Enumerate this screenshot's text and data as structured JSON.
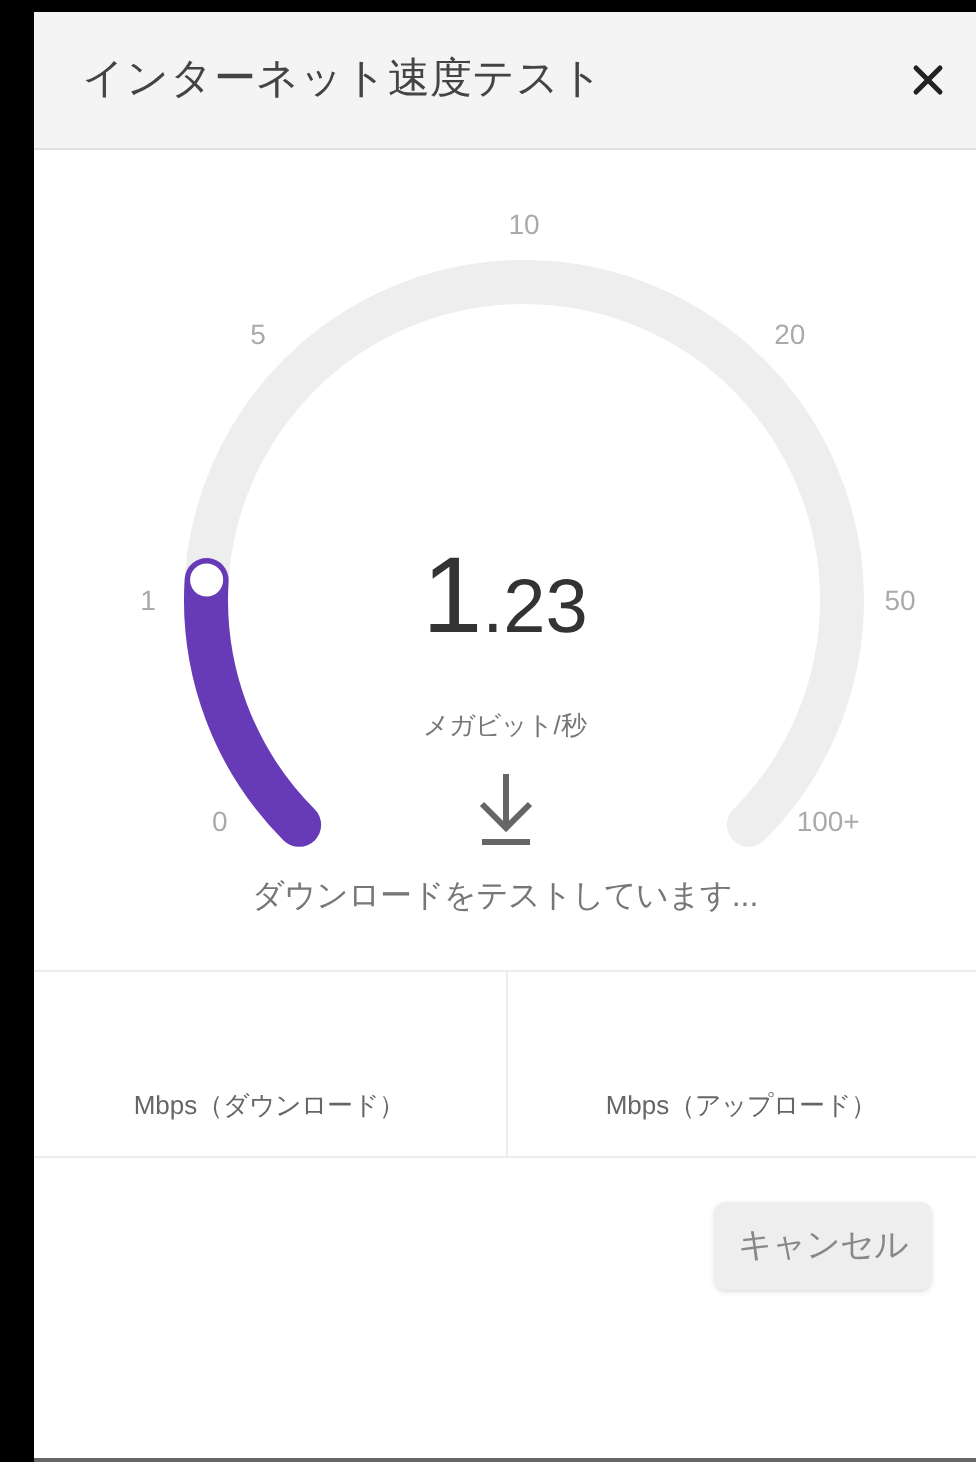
{
  "window": {
    "title": "インターネット速度テスト"
  },
  "gauge": {
    "scale": [
      "0",
      "1",
      "5",
      "10",
      "20",
      "50",
      "100+"
    ],
    "level": 0.18,
    "reading_whole": "1",
    "reading_fraction": ".23",
    "unit": "メガビット/秒"
  },
  "status": "ダウンロードをテストしています...",
  "results": [
    {
      "label": "Mbps（ダウンロード）"
    },
    {
      "label": "Mbps（アップロード）"
    }
  ],
  "buttons": [
    {
      "label": "キャンセル"
    }
  ]
}
